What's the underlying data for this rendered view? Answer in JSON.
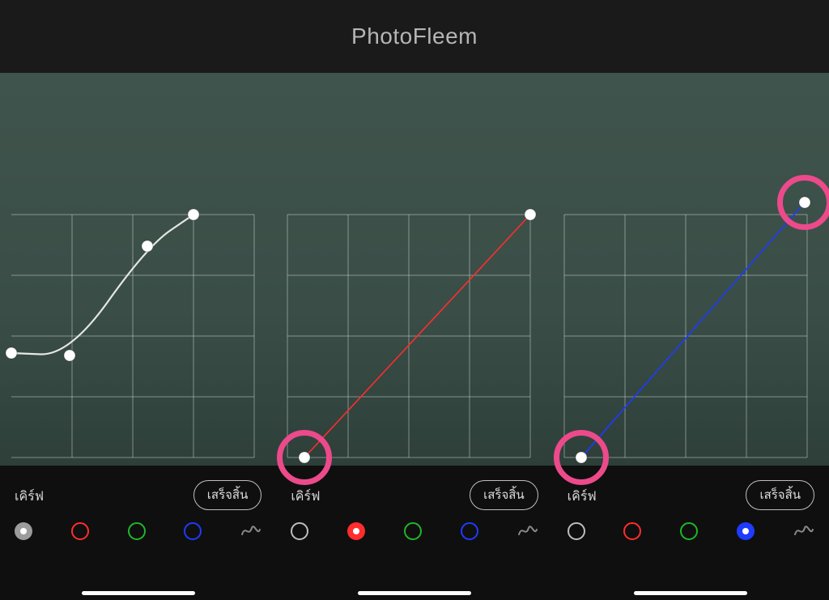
{
  "header": {
    "title": "PhotoFleem"
  },
  "labels": {
    "curve": "เคิร์ฟ",
    "done": "เสร็จสิ้น"
  },
  "colors": {
    "white": "#ffffff",
    "red": "#ff2d2d",
    "green": "#1fb62a",
    "blue": "#1e3bff",
    "grid": "rgba(230,236,233,0.45)",
    "curveStroke": "#e6e6e6",
    "highlight": "#ec4a8a"
  },
  "panels": [
    {
      "id": "luma",
      "activeChannel": "white",
      "curve": {
        "type": "spline",
        "stroke": "white",
        "points": [
          {
            "x": 0.0,
            "y": 0.43
          },
          {
            "x": 0.24,
            "y": 0.42
          },
          {
            "x": 0.56,
            "y": 0.87
          },
          {
            "x": 0.75,
            "y": 1.0
          }
        ]
      },
      "annotations": []
    },
    {
      "id": "red",
      "activeChannel": "red",
      "curve": {
        "type": "line",
        "stroke": "red",
        "points": [
          {
            "x": 0.07,
            "y": 0.0
          },
          {
            "x": 1.0,
            "y": 1.0
          }
        ]
      },
      "annotations": [
        {
          "at": "start"
        }
      ]
    },
    {
      "id": "blue",
      "activeChannel": "blue",
      "curve": {
        "type": "line",
        "stroke": "blue",
        "points": [
          {
            "x": 0.07,
            "y": 0.0
          },
          {
            "x": 0.99,
            "y": 1.05
          }
        ]
      },
      "annotations": [
        {
          "at": "start"
        },
        {
          "at": "end"
        }
      ]
    }
  ],
  "channels": [
    "white",
    "red",
    "green",
    "blue",
    "beauty"
  ],
  "chart_data": [
    {
      "type": "line",
      "title": "Luminance curve",
      "xlabel": "",
      "ylabel": "",
      "xlim": [
        0,
        1
      ],
      "ylim": [
        0,
        1
      ],
      "series": [
        {
          "name": "white",
          "x": [
            0.0,
            0.24,
            0.56,
            0.75
          ],
          "y": [
            0.43,
            0.42,
            0.87,
            1.0
          ]
        }
      ]
    },
    {
      "type": "line",
      "title": "Red channel curve",
      "xlabel": "",
      "ylabel": "",
      "xlim": [
        0,
        1
      ],
      "ylim": [
        0,
        1
      ],
      "series": [
        {
          "name": "red",
          "x": [
            0.07,
            1.0
          ],
          "y": [
            0.0,
            1.0
          ]
        }
      ]
    },
    {
      "type": "line",
      "title": "Blue channel curve",
      "xlabel": "",
      "ylabel": "",
      "xlim": [
        0,
        1
      ],
      "ylim": [
        0,
        1
      ],
      "series": [
        {
          "name": "blue",
          "x": [
            0.07,
            0.99
          ],
          "y": [
            0.0,
            1.05
          ]
        }
      ]
    }
  ]
}
